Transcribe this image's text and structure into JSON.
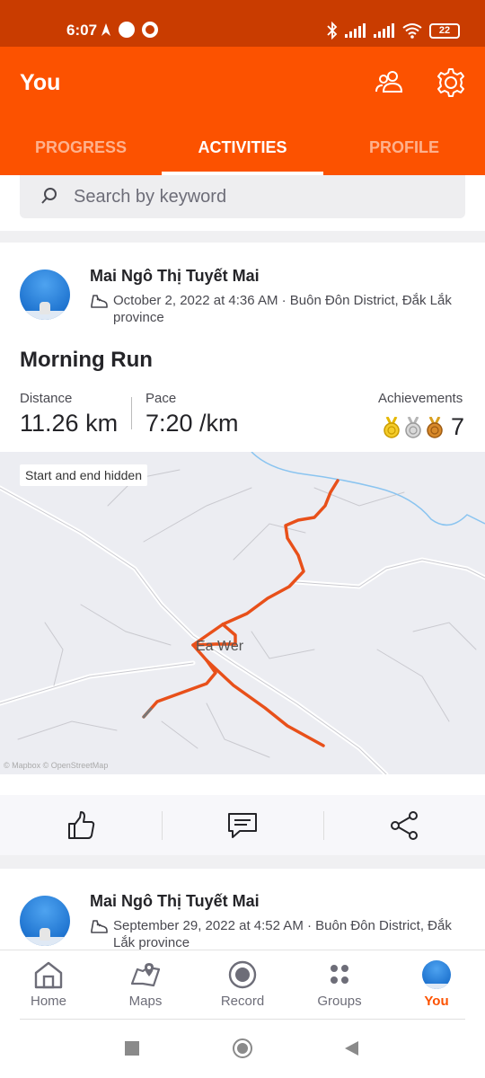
{
  "status_bar": {
    "time": "6:07",
    "battery": "22"
  },
  "header": {
    "title": "You",
    "tabs": [
      {
        "label": "PROGRESS",
        "active": false
      },
      {
        "label": "ACTIVITIES",
        "active": true
      },
      {
        "label": "PROFILE",
        "active": false
      }
    ]
  },
  "search": {
    "placeholder": "Search by keyword",
    "value": ""
  },
  "activities": [
    {
      "athlete": "Mai Ngô Thị Tuyết Mai",
      "meta": "October 2, 2022 at 4:36 AM · Buôn Đôn District, Đắk Lắk province",
      "title": "Morning Run",
      "stats": {
        "distance_label": "Distance",
        "distance_value": "11.26 km",
        "pace_label": "Pace",
        "pace_value": "7:20 /km",
        "achievements_label": "Achievements",
        "achievements_value": "7"
      },
      "map": {
        "badge": "Start and end hidden",
        "place": "Ea Wer",
        "credit": "© Mapbox © OpenStreetMap"
      }
    },
    {
      "athlete": "Mai Ngô Thị Tuyết Mai",
      "meta": "September 29, 2022 at 4:52 AM · Buôn Đôn District, Đắk Lắk province"
    }
  ],
  "bottom_nav": [
    {
      "label": "Home",
      "icon": "home-icon",
      "active": false
    },
    {
      "label": "Maps",
      "icon": "map-icon",
      "active": false
    },
    {
      "label": "Record",
      "icon": "record-icon",
      "active": false
    },
    {
      "label": "Groups",
      "icon": "groups-icon",
      "active": false
    },
    {
      "label": "You",
      "icon": "avatar",
      "active": true
    }
  ],
  "colors": {
    "brand": "#fc5200",
    "status_bar": "#c93c00",
    "route": "#e8501a"
  }
}
